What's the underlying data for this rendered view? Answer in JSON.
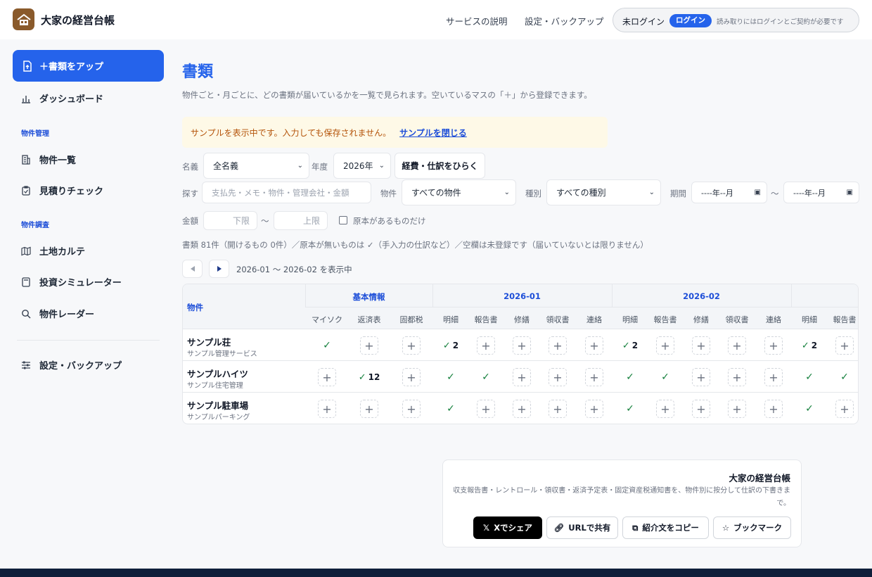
{
  "app": {
    "title": "大家の経営台帳"
  },
  "header": {
    "nav": [
      "サービスの説明",
      "設定・バックアップ"
    ],
    "login_status": "未ログイン",
    "login_button": "ログイン",
    "login_note": "読み取りにはログインとご契約が必要です"
  },
  "sidebar": {
    "upload_label": "＋書類をアップ",
    "dashboard": "ダッシュボード",
    "section_property": "物件管理",
    "property_list": "物件一覧",
    "estimate_check": "見積りチェック",
    "section_research": "物件調査",
    "land_karte": "土地カルテ",
    "invest_sim": "投資シミュレーター",
    "property_radar": "物件レーダー",
    "settings": "設定・バックアップ"
  },
  "main": {
    "title": "書類",
    "description": "物件ごと・月ごとに、どの書類が届いているかを一覧で見られます。空いているマスの「＋」から登録できます。",
    "sample_notice": "サンプルを表示中です。入力しても保存されません。",
    "sample_close": "サンプルを閉じる"
  },
  "filters": {
    "name_label": "名義",
    "name_value": "全名義",
    "year_label": "年度",
    "year_value": "2026年",
    "open_button": "経費・仕訳をひらく",
    "search_label": "探す",
    "search_placeholder": "支払先・メモ・物件・管理会社・金額",
    "property_label": "物件",
    "property_value": "すべての物件",
    "type_label": "種別",
    "type_value": "すべての種別",
    "period_label": "期間",
    "date_placeholder": "----年--月",
    "tilde": "〜",
    "amount_label": "金額",
    "amount_min": "下限",
    "amount_max": "上限",
    "original_only": "原本があるものだけ"
  },
  "summary": "書類 81件（開けるもの 0件）／原本が無いものは ✓（手入力の仕訳など）／空欄は未登録です（届いていないとは限りません）",
  "pager": {
    "range": "2026-01 〜 2026-02 を表示中"
  },
  "table": {
    "property_header": "物件",
    "groups": [
      "基本情報",
      "2026-01",
      "2026-02"
    ],
    "basic_cols": [
      "マイソク",
      "返済表",
      "固都税"
    ],
    "month_cols": [
      "明細",
      "報告書",
      "修繕",
      "領収書",
      "連絡"
    ],
    "overflow_cols": [
      "明細",
      "報告書"
    ],
    "rows": [
      {
        "name": "サンプル荘",
        "company": "サンプル管理サービス",
        "cells": [
          {
            "t": "check"
          },
          {
            "t": "plus"
          },
          {
            "t": "plus"
          },
          {
            "t": "checknum",
            "n": "2"
          },
          {
            "t": "plus"
          },
          {
            "t": "plus"
          },
          {
            "t": "plus"
          },
          {
            "t": "plus"
          },
          {
            "t": "checknum",
            "n": "2"
          },
          {
            "t": "plus"
          },
          {
            "t": "plus"
          },
          {
            "t": "plus"
          },
          {
            "t": "plus"
          },
          {
            "t": "checknum",
            "n": "2"
          },
          {
            "t": "plus"
          }
        ]
      },
      {
        "name": "サンプルハイツ",
        "company": "サンプル住宅管理",
        "cells": [
          {
            "t": "plus"
          },
          {
            "t": "checknum",
            "n": "12"
          },
          {
            "t": "plus"
          },
          {
            "t": "check"
          },
          {
            "t": "check"
          },
          {
            "t": "plus"
          },
          {
            "t": "plus"
          },
          {
            "t": "plus"
          },
          {
            "t": "check"
          },
          {
            "t": "check"
          },
          {
            "t": "plus"
          },
          {
            "t": "plus"
          },
          {
            "t": "plus"
          },
          {
            "t": "check"
          },
          {
            "t": "check"
          }
        ]
      },
      {
        "name": "サンプル駐車場",
        "company": "サンプルパーキング",
        "cells": [
          {
            "t": "plus"
          },
          {
            "t": "plus"
          },
          {
            "t": "plus"
          },
          {
            "t": "check"
          },
          {
            "t": "plus"
          },
          {
            "t": "plus"
          },
          {
            "t": "plus"
          },
          {
            "t": "plus"
          },
          {
            "t": "check"
          },
          {
            "t": "plus"
          },
          {
            "t": "plus"
          },
          {
            "t": "plus"
          },
          {
            "t": "plus"
          },
          {
            "t": "check"
          },
          {
            "t": "plus"
          }
        ]
      }
    ]
  },
  "share": {
    "title": "大家の経営台帳",
    "description": "収支報告書・レントロール・領収書・返済予定表・固定資産税通知書を、物件別に按分して仕訳の下書きまで。",
    "x_share": "Xでシェア",
    "url_share": "URLで共有",
    "copy_intro": "紹介文をコピー",
    "bookmark": "ブックマーク"
  }
}
